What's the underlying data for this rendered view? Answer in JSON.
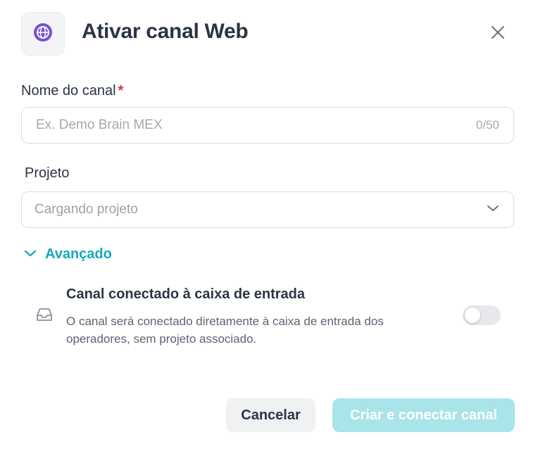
{
  "header": {
    "icon": "globe-icon",
    "title": "Ativar canal Web",
    "close_icon": "close-icon"
  },
  "channel_name": {
    "label": "Nome do canal",
    "required_marker": "*",
    "placeholder": "Ex. Demo Brain MEX",
    "value": "",
    "counter": "0/50"
  },
  "project": {
    "label": "Projeto",
    "selected": "Cargando projeto",
    "icon": "chevron-down-icon"
  },
  "advanced": {
    "label": "Avançado",
    "expanded": true,
    "icon": "chevron-down-icon"
  },
  "inbox_option": {
    "icon": "inbox-icon",
    "title": "Canal conectado à caixa de entrada",
    "description": "O canal será conectado diretamente à caixa de entrada dos operadores, sem projeto associado.",
    "enabled": false
  },
  "footer": {
    "cancel_label": "Cancelar",
    "create_label": "Criar e conectar canal"
  },
  "colors": {
    "accent": "#14a9b8",
    "accent_disabled": "#a9e4ea",
    "globe": "#7b4fd6",
    "required": "#e0313f"
  }
}
